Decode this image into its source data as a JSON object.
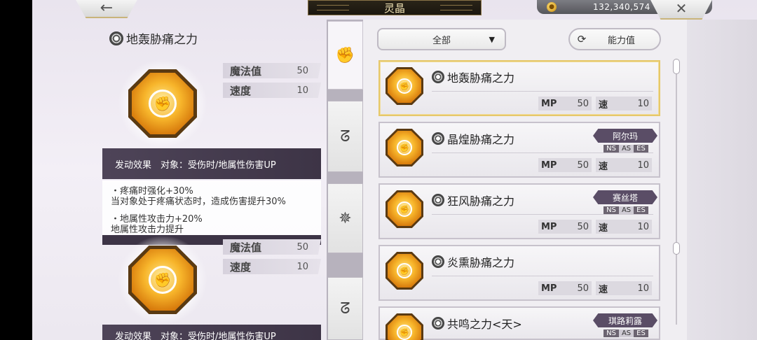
{
  "topbar": {
    "back_icon": "←",
    "title": "灵晶",
    "coin_icon": "gold-coin-icon",
    "coins": "132,340,574",
    "close_icon": "✕"
  },
  "detail": {
    "name": "地轰胁痛之力",
    "stats": [
      {
        "label": "魔法值",
        "value": "50"
      },
      {
        "label": "速度",
        "value": "10"
      }
    ],
    "effect_header": "发动效果　对象：受伤时/地属性伤害UP",
    "effects": [
      {
        "line1": "・疼痛时强化+30%",
        "line2": "当对象处于疼痛状态时，造成伤害提升30%"
      },
      {
        "line1": "・地属性攻击力+20%",
        "line2": "地属性攻击力提升"
      }
    ],
    "lower_stats": [
      {
        "label": "魔法值",
        "value": "50"
      },
      {
        "label": "速度",
        "value": "10"
      }
    ],
    "lower_effect_header": "发动效果　对象：受伤时/地属性伤害UP"
  },
  "tabs": [
    {
      "icon": "fist-icon",
      "glyph": "✊"
    },
    {
      "icon": "wind-swirl-icon",
      "glyph": "ᘔ"
    },
    {
      "icon": "emblem-icon",
      "glyph": "✵"
    },
    {
      "icon": "wind-swirl-icon",
      "glyph": "ᘔ"
    }
  ],
  "filters": {
    "dropdown_value": "全部",
    "sort_label": "能力值"
  },
  "cards": [
    {
      "name": "地轰胁痛之力",
      "mp_label": "MP",
      "mp": "50",
      "spd_label": "速",
      "spd": "10",
      "owner": "",
      "tiers": []
    },
    {
      "name": "晶煌胁痛之力",
      "mp_label": "MP",
      "mp": "50",
      "spd_label": "速",
      "spd": "10",
      "owner": "阿尔玛",
      "tiers": [
        "NS",
        "AS",
        "ES"
      ]
    },
    {
      "name": "狂风胁痛之力",
      "mp_label": "MP",
      "mp": "50",
      "spd_label": "速",
      "spd": "10",
      "owner": "赛丝塔",
      "tiers": [
        "NS",
        "AS",
        "ES"
      ]
    },
    {
      "name": "炎熏胁痛之力",
      "mp_label": "MP",
      "mp": "50",
      "spd_label": "速",
      "spd": "10",
      "owner": "",
      "tiers": []
    },
    {
      "name": "共鸣之力<天>",
      "mp_label": "",
      "mp": "",
      "spd_label": "",
      "spd": "",
      "owner": "琪路莉露",
      "tiers": [
        "NS",
        "AS",
        "ES"
      ]
    }
  ]
}
